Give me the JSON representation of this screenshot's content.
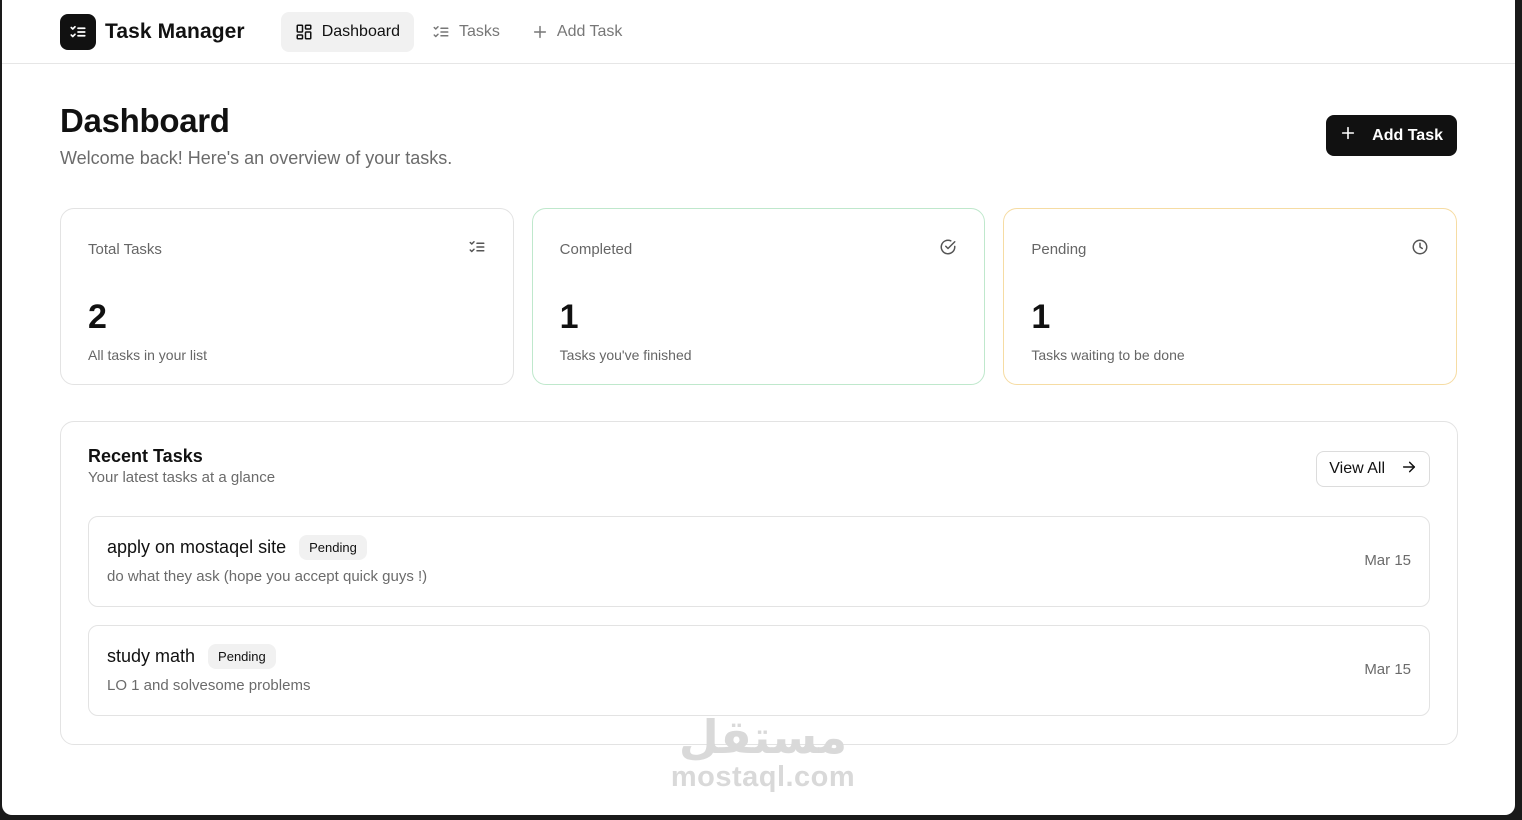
{
  "app": {
    "name": "Task Manager"
  },
  "nav": {
    "items": [
      {
        "label": "Dashboard",
        "icon": "grid-icon",
        "active": true
      },
      {
        "label": "Tasks",
        "icon": "list-checks-icon",
        "active": false
      },
      {
        "label": "Add Task",
        "icon": "plus-icon",
        "active": false
      }
    ]
  },
  "page": {
    "title": "Dashboard",
    "subtitle": "Welcome back! Here's an overview of your tasks.",
    "add_button_label": "Add Task"
  },
  "stats": [
    {
      "label": "Total Tasks",
      "value": "2",
      "description": "All tasks in your list",
      "icon": "list-checks-icon"
    },
    {
      "label": "Completed",
      "value": "1",
      "description": "Tasks you've finished",
      "icon": "check-circle-icon",
      "accent": "#bfe8cc"
    },
    {
      "label": "Pending",
      "value": "1",
      "description": "Tasks waiting to be done",
      "icon": "clock-icon",
      "accent": "#f6dca3"
    }
  ],
  "recent": {
    "title": "Recent Tasks",
    "subtitle": "Your latest tasks at a glance",
    "view_all_label": "View All",
    "tasks": [
      {
        "title": "apply on mostaqel site",
        "status": "Pending",
        "description": "do what they ask (hope you accept quick guys !)",
        "date": "Mar 15"
      },
      {
        "title": "study math",
        "status": "Pending",
        "description": "LO 1 and solvesome problems",
        "date": "Mar 15"
      }
    ]
  },
  "watermark": {
    "arabic": "مستقل",
    "latin": "mostaql.com"
  },
  "colors": {
    "primary": "#111111",
    "completed_border": "#bfe8cc",
    "pending_border": "#f6dca3"
  }
}
